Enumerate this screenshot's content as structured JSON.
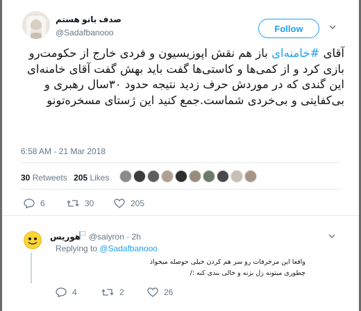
{
  "tweet": {
    "author_name": "صدف بانو هستم",
    "author_handle": "@Sadafbanooo",
    "follow_label": "Follow",
    "text_pre": "آقای ",
    "hashtag": "#خامنه‌ای",
    "text_post": " باز هم نقش اپوزیسیون و فردی خارج از حکومت‌رو بازی کرد و از کمی‌ها و کاستی‌ها گفت باید بهش گفت آقای خامنه‌ای این گندی که در موردش حرف زدید نتیجه حدود ۳۰سال رهبری و بی‌کفایتی و بی‌خردی شماست.جمع کنید این ژستای مسخره‌تونو",
    "timestamp": "6:58 AM - 21 Mar 2018",
    "retweets_count": "30",
    "retweets_label": "Retweets",
    "likes_count": "205",
    "likes_label": "Likes",
    "actions": {
      "replies": "6",
      "retweets": "30",
      "likes": "205"
    }
  },
  "reply": {
    "author_name": "هوریس",
    "author_handle": "@saiyron",
    "time": "· 2h",
    "replying_prefix": "Replying to",
    "replying_to": "@Sadafbanooo",
    "line1": "واقعا این مزخرفات رو سر هم کردن خیلی حوصله میخواد",
    "line2": "چطوری میتونه زل بزنه و خالی بندی کنه :/",
    "actions": {
      "replies": "4",
      "retweets": "2",
      "likes": "26"
    }
  },
  "icons": {
    "follow": "follow-button",
    "reply": "reply-icon",
    "retweet": "retweet-icon",
    "like": "heart-icon",
    "more": "chevron-down-icon"
  },
  "colors": {
    "accent": "#1da1f2",
    "muted": "#657786",
    "text": "#14171a"
  }
}
